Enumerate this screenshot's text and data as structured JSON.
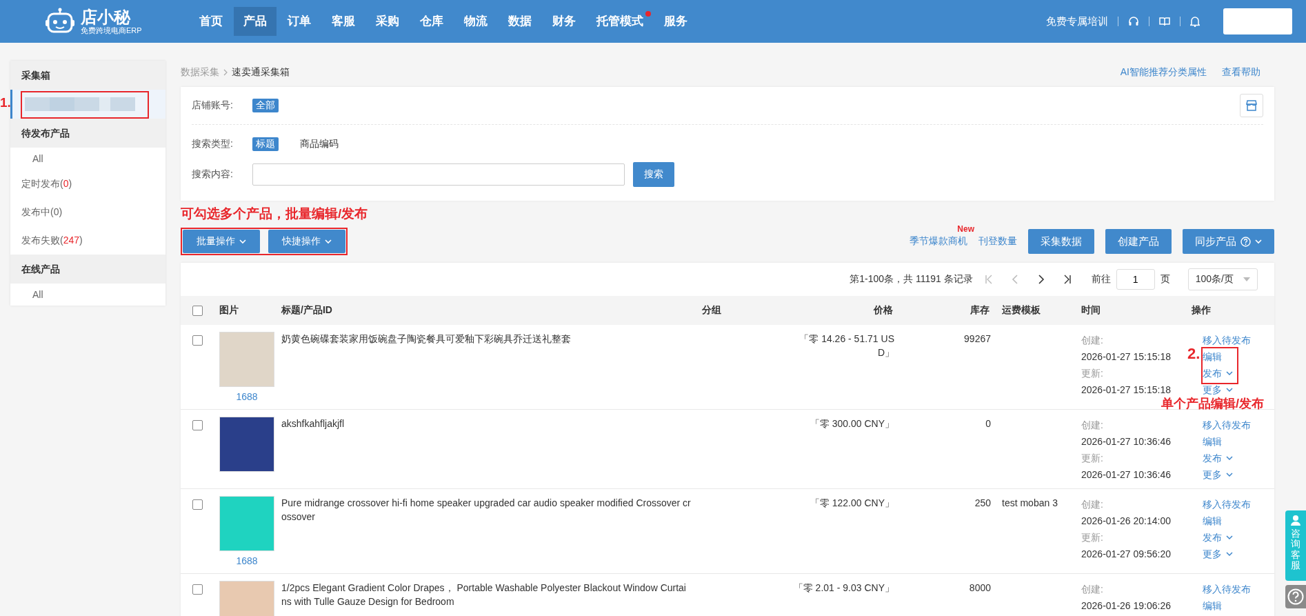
{
  "header": {
    "logo": {
      "name": "店小秘",
      "tagline": "免费跨境电商ERP"
    },
    "nav": [
      {
        "label": "首页",
        "selected": false,
        "dot": false
      },
      {
        "label": "产品",
        "selected": true,
        "dot": false
      },
      {
        "label": "订单",
        "selected": false,
        "dot": false
      },
      {
        "label": "客服",
        "selected": false,
        "dot": false
      },
      {
        "label": "采购",
        "selected": false,
        "dot": false
      },
      {
        "label": "仓库",
        "selected": false,
        "dot": false
      },
      {
        "label": "物流",
        "selected": false,
        "dot": false
      },
      {
        "label": "数据",
        "selected": false,
        "dot": false
      },
      {
        "label": "财务",
        "selected": false,
        "dot": false
      },
      {
        "label": "托管模式",
        "selected": false,
        "dot": true
      },
      {
        "label": "服务",
        "selected": false,
        "dot": false
      }
    ],
    "training_link": "免费专属培训"
  },
  "sidebar": {
    "sections": [
      {
        "title": "采集箱",
        "items": [
          {
            "kind": "redacted",
            "selected": true
          }
        ]
      },
      {
        "title": "待发布产品",
        "items": [
          {
            "kind": "sub",
            "label": "All",
            "selected": false
          },
          {
            "kind": "count",
            "before": "定时发布(",
            "count": "0",
            "after": ")",
            "alert": true,
            "selected": false
          },
          {
            "kind": "count",
            "before": "发布中(",
            "count": "0",
            "after": ")",
            "alert": false,
            "selected": false
          },
          {
            "kind": "count",
            "before": "发布失败(",
            "count": "247",
            "after": ")",
            "alert": true,
            "selected": false
          }
        ]
      },
      {
        "title": "在线产品",
        "items": [
          {
            "kind": "sub",
            "label": "All",
            "selected": false
          }
        ]
      }
    ]
  },
  "breadcrumb": [
    "数据采集",
    "速卖通采集箱"
  ],
  "top_links": [
    "AI智能推荐分类属性",
    "查看帮助"
  ],
  "filters": {
    "shop_account": {
      "label": "店铺账号:",
      "options": [
        {
          "label": "全部",
          "selected": true
        }
      ]
    },
    "search_type": {
      "label": "搜索类型:",
      "options": [
        {
          "label": "标题",
          "selected": true
        },
        {
          "label": "商品编码",
          "selected": false
        }
      ]
    },
    "search_content": {
      "label": "搜索内容:",
      "button": "搜索"
    }
  },
  "annotations": {
    "step1": "1.",
    "batch_hint": "可勾选多个产品，批量编辑/发布",
    "step2": "2.",
    "single_hint": "单个产品编辑/发布"
  },
  "toolbar": {
    "left_buttons": [
      "批量操作",
      "快捷操作"
    ],
    "links": [
      {
        "label": "季节爆款商机",
        "badge": "New"
      },
      {
        "label": "刊登数量"
      }
    ],
    "buttons": [
      {
        "label": "采集数据",
        "kind": "plain"
      },
      {
        "label": "创建产品",
        "kind": "plain"
      },
      {
        "label": "同步产品",
        "kind": "dropdown"
      }
    ]
  },
  "pagination": {
    "summary": "第1-100条，共 11191 条记录",
    "nav": [
      {
        "kind": "first",
        "disabled": true
      },
      {
        "kind": "prev",
        "disabled": true
      },
      {
        "kind": "next",
        "disabled": false
      },
      {
        "kind": "last",
        "disabled": false
      }
    ],
    "goto": "前往",
    "page": "1",
    "page_unit": "页",
    "page_size": "100条/页"
  },
  "table": {
    "all_checked": false,
    "columns": [
      "图片",
      "标题/产品ID",
      "分组",
      "价格",
      "库存",
      "运费模板",
      "时间",
      "操作"
    ],
    "rows": [
      {
        "checked": false,
        "source": "1688",
        "title": "奶黄色碗碟套装家用饭碗盘子陶瓷餐具可爱釉下彩碗具乔迁送礼整套",
        "price": "「零 14.26 - 51.71 USD」",
        "stock": "99267",
        "template": "",
        "times": [
          {
            "label": "创建:",
            "value": "2026-01-27 15:15:18"
          },
          {
            "label": "更新:",
            "value": "2026-01-27 15:15:18"
          }
        ],
        "actions": [
          {
            "label": "移入待发布",
            "dropdown": false
          },
          {
            "label": "编辑",
            "dropdown": false
          },
          {
            "label": "发布",
            "dropdown": true
          },
          {
            "label": "更多",
            "dropdown": true
          }
        ]
      },
      {
        "checked": false,
        "source": "",
        "title": "akshfkahfljakjfl",
        "price": "「零 300.00 CNY」",
        "stock": "0",
        "template": "",
        "times": [
          {
            "label": "创建:",
            "value": "2026-01-27 10:36:46"
          },
          {
            "label": "更新:",
            "value": "2026-01-27 10:36:46"
          }
        ],
        "actions": [
          {
            "label": "移入待发布",
            "dropdown": false
          },
          {
            "label": "编辑",
            "dropdown": false
          },
          {
            "label": "发布",
            "dropdown": true
          },
          {
            "label": "更多",
            "dropdown": true
          }
        ]
      },
      {
        "checked": false,
        "source": "1688",
        "title": "Pure midrange crossover hi-fi home speaker upgraded car audio speaker modified Crossover crossover",
        "price": "「零 122.00 CNY」",
        "stock": "250",
        "template": "test moban 3",
        "times": [
          {
            "label": "创建:",
            "value": "2026-01-26 20:14:00"
          },
          {
            "label": "更新:",
            "value": "2026-01-27 09:56:20"
          }
        ],
        "actions": [
          {
            "label": "移入待发布",
            "dropdown": false
          },
          {
            "label": "编辑",
            "dropdown": false
          },
          {
            "label": "发布",
            "dropdown": true
          },
          {
            "label": "更多",
            "dropdown": true
          }
        ]
      },
      {
        "checked": false,
        "source": "",
        "title": "1/2pcs Elegant Gradient Color Drapes， Portable Washable Polyester Blackout Window Curtains with Tulle Gauze Design for Bedroom",
        "price": "「零 2.01 - 9.03 CNY」",
        "stock": "8000",
        "template": "",
        "times": [
          {
            "label": "创建:",
            "value": "2026-01-26 19:06:26"
          }
        ],
        "actions": [
          {
            "label": "移入待发布",
            "dropdown": false
          },
          {
            "label": "编辑",
            "dropdown": false
          }
        ]
      }
    ]
  },
  "float_service": "咨询客服"
}
